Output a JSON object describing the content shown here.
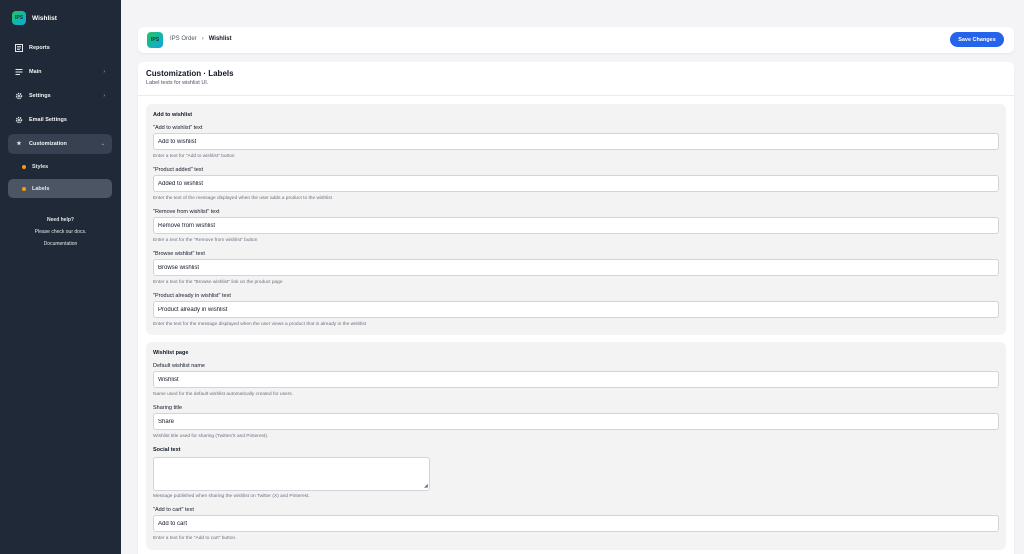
{
  "app": {
    "logo_text": "IPS",
    "name": "Wishlist"
  },
  "sidebar": {
    "items": [
      {
        "label": "Reports"
      },
      {
        "label": "Main"
      },
      {
        "label": "Settings"
      },
      {
        "label": "Email Settings"
      },
      {
        "label": "Customization"
      }
    ],
    "subitems": [
      {
        "label": "Styles"
      },
      {
        "label": "Labels"
      }
    ],
    "help": {
      "title": "Need help?",
      "text": "Please check our docs.",
      "link": "Documentation"
    }
  },
  "header": {
    "logo_text": "IPS",
    "breadcrumb_parent": "IPS Order",
    "breadcrumb_sep": "›",
    "breadcrumb_current": "Wishlist",
    "save_label": "Save Changes"
  },
  "page": {
    "title": "Customization · Labels",
    "subtitle": "Label texts for wishlist UI."
  },
  "sections": {
    "add_to_wishlist": {
      "title": "Add to wishlist",
      "fields": [
        {
          "label": "\"Add to wishlist\" text",
          "value": "Add to wishlist",
          "help": "Enter a text for \"Add to wishlist\" button"
        },
        {
          "label": "\"Product added\" text",
          "value": "Added to wishlist",
          "help": "Enter the text of the message displayed when the user adds a product to the wishlist"
        },
        {
          "label": "\"Remove from wishlist\" text",
          "value": "Remove from wishlist",
          "help": "Enter a text for the \"Remove from wishlist\" button"
        },
        {
          "label": "\"Browse wishlist\" text",
          "value": "Browse wishlist",
          "help": "Enter a text for the \"Browse wishlist\" link on the product page"
        },
        {
          "label": "\"Product already in wishlist\" text",
          "value": "Product already in wishlist",
          "help": "Enter the text for the message displayed when the user views a product that is already in the wishlist"
        }
      ]
    },
    "wishlist_page": {
      "title": "Wishlist page",
      "fields": [
        {
          "label": "Default wishlist name",
          "value": "Wishlist",
          "help": "Name used for the default wishlist automatically created for users."
        },
        {
          "label": "Sharing title",
          "value": "Share",
          "help": "Wishlist title used for sharing (Twitter/X and Pinterest)."
        },
        {
          "label": "Social text",
          "value": "",
          "help": "Message published when sharing the wishlist on Twitter (X) and Pinterest."
        },
        {
          "label": "\"Add to cart\" text",
          "value": "Add to cart",
          "help": "Enter a text for the \"Add to cart\" button."
        }
      ]
    }
  },
  "colors": {
    "sidebar_bg": "#1f2937",
    "accent": "#2563eb",
    "dot": "#f59e0b"
  }
}
